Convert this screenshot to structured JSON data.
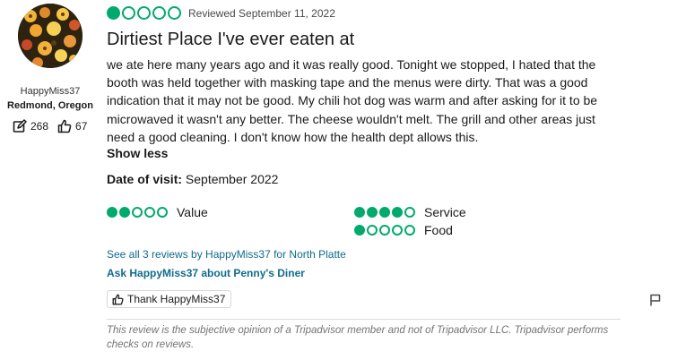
{
  "user": {
    "name": "HappyMiss37",
    "location": "Redmond, Oregon",
    "contributions": "268",
    "helpful_votes": "67"
  },
  "review": {
    "rating": 1,
    "reviewed_date": "Reviewed September 11, 2022",
    "title": "Dirtiest Place I've ever eaten at",
    "text": "we ate here many years ago and it was really good. Tonight we stopped, I hated that the booth was held together with masking tape and the menus were dirty. That was a good indication that it may not be good. My chili hot dog was warm and after asking for it to be microwaved it wasn't any better. The cheese wouldn't melt. The grill and other areas just need a good cleaning. I don't know how the health dept allows this.",
    "show_less": "Show less",
    "date_of_visit_label": "Date of visit:",
    "date_of_visit": "September 2022",
    "subratings": [
      {
        "label": "Value",
        "rating": 2
      },
      {
        "label": "Service",
        "rating": 4
      },
      {
        "label": "Food",
        "rating": 1
      }
    ],
    "see_all_link": "See all 3 reviews by HappyMiss37 for North Platte",
    "ask_link": "Ask HappyMiss37 about Penny's Diner",
    "thank_button": "Thank HappyMiss37",
    "disclaimer": "This review is the subjective opinion of a Tripadvisor member and not of Tripadvisor LLC. Tripadvisor performs checks on reviews."
  },
  "colors": {
    "bubble": "#00aa6c",
    "link": "#0f6b8c"
  },
  "icons": {
    "contributions": "edit-icon",
    "helpful": "thumbs-up-icon",
    "report": "flag-icon"
  }
}
